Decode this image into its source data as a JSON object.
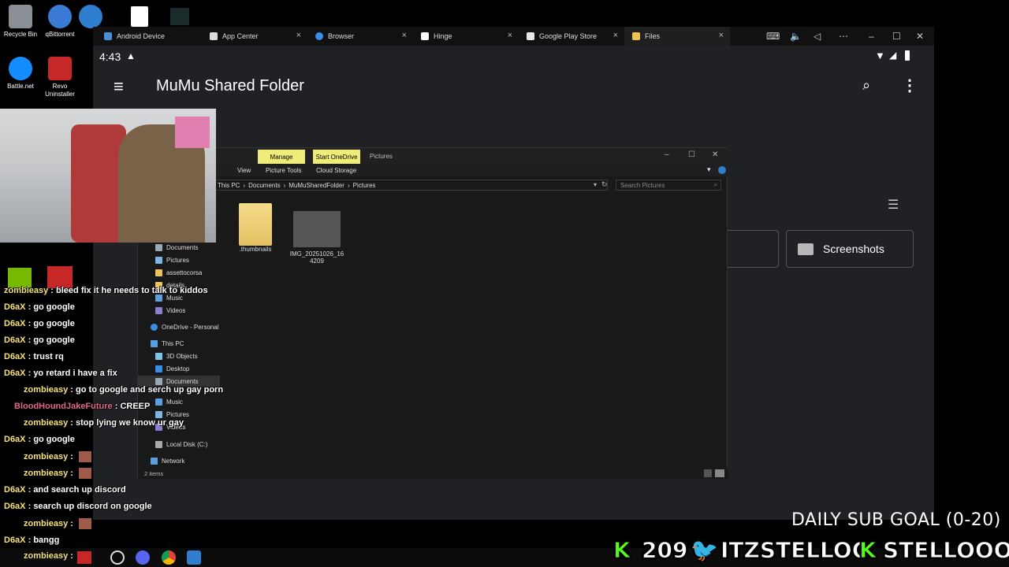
{
  "desktop": {
    "icons": [
      {
        "label": "Recycle Bin"
      },
      {
        "label": "qBittorrent"
      },
      {
        "label": "Battle.net"
      },
      {
        "label": "Revo Uninstaller"
      }
    ]
  },
  "emulator": {
    "tabs": [
      {
        "label": "Android Device"
      },
      {
        "label": "App Center"
      },
      {
        "label": "Browser"
      },
      {
        "label": "Hinge"
      },
      {
        "label": "Google Play Store"
      },
      {
        "label": "Files"
      }
    ],
    "status": {
      "time": "4:43"
    },
    "appbar": {
      "title": "MuMu Shared Folder"
    },
    "folders": [
      {
        "label": "Screenshots"
      }
    ]
  },
  "explorer": {
    "title": {
      "manage": "Manage",
      "onedrive": "Start OneDrive",
      "name": "Pictures"
    },
    "ribbon": {
      "view": "View",
      "picture_tools": "Picture Tools",
      "cloud_storage": "Cloud Storage"
    },
    "breadcrumb": [
      "This PC",
      "Documents",
      "MuMuSharedFolder",
      "Pictures"
    ],
    "search_placeholder": "Search Pictures",
    "nav": [
      {
        "label": "Documents"
      },
      {
        "label": "Pictures"
      },
      {
        "label": "assettocorsa"
      },
      {
        "label": "details"
      },
      {
        "label": "Music"
      },
      {
        "label": "Videos"
      },
      {
        "label": "OneDrive - Personal"
      },
      {
        "label": "This PC"
      },
      {
        "label": "3D Objects"
      },
      {
        "label": "Desktop"
      },
      {
        "label": "Documents"
      },
      {
        "label": "Music"
      },
      {
        "label": "Pictures"
      },
      {
        "label": "Videos"
      },
      {
        "label": "Local Disk (C:)"
      },
      {
        "label": "Network"
      }
    ],
    "files": [
      {
        "name": ".thumbnails"
      },
      {
        "name": "IMG_20251026_164209"
      }
    ],
    "status": "2 items"
  },
  "chat": [
    {
      "user": "zombieasy",
      "msg": "bleed fix it he needs to talk to kiddos"
    },
    {
      "user": "D6aX",
      "msg": "go google"
    },
    {
      "user": "D6aX",
      "msg": "go google"
    },
    {
      "user": "D6aX",
      "msg": "go google"
    },
    {
      "user": "D6aX",
      "msg": "trust rq"
    },
    {
      "user": "D6aX",
      "msg": "yo retard i have a fix"
    },
    {
      "user": "zombieasy",
      "msg": "go to google and serch up gay porn"
    },
    {
      "user": "BloodHoundJakeFuture",
      "msg": "CREEP"
    },
    {
      "user": "zombieasy",
      "msg": "stop lying we know ur gay"
    },
    {
      "user": "D6aX",
      "msg": "go google"
    },
    {
      "user": "zombieasy",
      "msg": ""
    },
    {
      "user": "zombieasy",
      "msg": ""
    },
    {
      "user": "D6aX",
      "msg": "and search up discord"
    },
    {
      "user": "D6aX",
      "msg": "search up discord on google"
    },
    {
      "user": "zombieasy",
      "msg": ""
    },
    {
      "user": "D6aX",
      "msg": "bangg"
    },
    {
      "user": "zombieasy",
      "msg": ""
    }
  ],
  "overlay": {
    "goal": "DAILY SUB GOAL (0-20)",
    "kick_count": "209",
    "twitter": "ITZSTELLOO",
    "kick_name": "STELLOOO"
  }
}
